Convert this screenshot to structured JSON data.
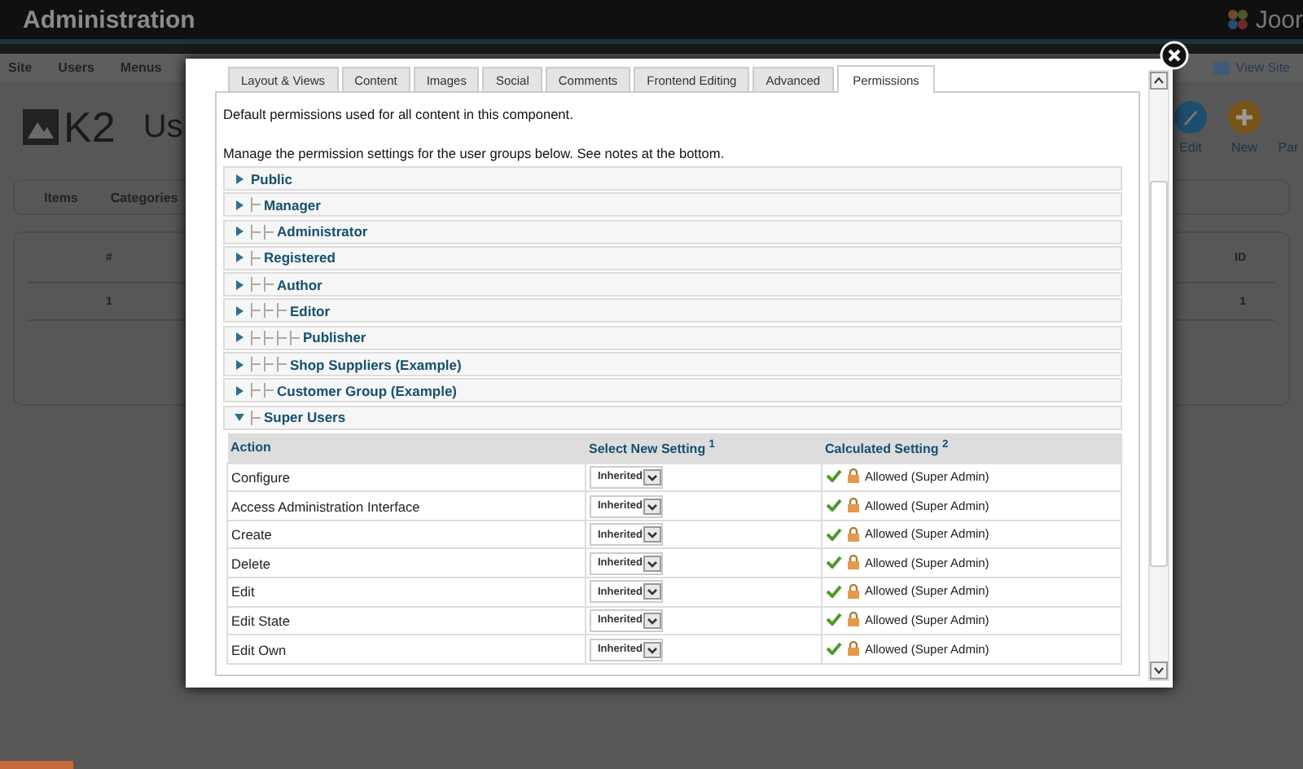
{
  "header": {
    "title": "Administration",
    "logo_text": "Joor"
  },
  "menu": [
    "Site",
    "Users",
    "Menus"
  ],
  "menu_right": {
    "label": "View Site"
  },
  "component": {
    "logo": "K2",
    "title": "Us"
  },
  "toolbar": [
    {
      "label": "Edit",
      "kind": "edit"
    },
    {
      "label": "New",
      "kind": "new"
    },
    {
      "label": "Par",
      "kind": "other"
    }
  ],
  "submenu": [
    "Items",
    "Categories"
  ],
  "list": {
    "columns": [
      "#",
      "ID"
    ],
    "rows": [
      [
        "1",
        "1"
      ]
    ]
  },
  "dialog": {
    "tabs": [
      {
        "label": "Layout & Views",
        "selected": false
      },
      {
        "label": "Content",
        "selected": false
      },
      {
        "label": "Images",
        "selected": false
      },
      {
        "label": "Social",
        "selected": false
      },
      {
        "label": "Comments",
        "selected": false
      },
      {
        "label": "Frontend Editing",
        "selected": false
      },
      {
        "label": "Advanced",
        "selected": false
      },
      {
        "label": "Permissions",
        "selected": true
      }
    ],
    "intro": [
      "Default permissions used for all content in this component.",
      "Manage the permission settings for the user groups below. See notes at the bottom."
    ],
    "groups": [
      {
        "name": "Public",
        "expanded": false,
        "children": [
          {
            "name": "Manager",
            "expanded": false,
            "children": [
              {
                "name": "Administrator",
                "expanded": false
              }
            ]
          },
          {
            "name": "Registered",
            "expanded": false,
            "children": [
              {
                "name": "Author",
                "expanded": false,
                "children": [
                  {
                    "name": "Editor",
                    "expanded": false,
                    "children": [
                      {
                        "name": "Publisher",
                        "expanded": false
                      }
                    ]
                  },
                  {
                    "name": "Shop Suppliers (Example)",
                    "expanded": false
                  }
                ]
              },
              {
                "name": "Customer Group (Example)",
                "expanded": false
              }
            ]
          },
          {
            "name": "Super Users",
            "expanded": true,
            "permissions": {
              "columns": [
                "Action",
                "Select New Setting $^{1}$",
                "Calculated Setting $^{2}$"
              ],
              "rows": [
                {
                  "action": "Configure",
                  "setting": "Inherited",
                  "calculated": "Allowed (Super Admin)"
                },
                {
                  "action": "Access Administration Interface",
                  "setting": "Inherited",
                  "calculated": "Allowed (Super Admin)"
                },
                {
                  "action": "Create",
                  "setting": "Inherited",
                  "calculated": "Allowed (Super Admin)"
                },
                {
                  "action": "Delete",
                  "setting": "Inherited",
                  "calculated": "Allowed (Super Admin)"
                },
                {
                  "action": "Edit",
                  "setting": "Inherited",
                  "calculated": "Allowed (Super Admin)"
                },
                {
                  "action": "Edit State",
                  "setting": "Inherited",
                  "calculated": "Allowed (Super Admin)"
                },
                {
                  "action": "Edit Own",
                  "setting": "Inherited",
                  "calculated": "Allowed (Super Admin)"
                }
              ]
            }
          }
        ]
      }
    ]
  }
}
